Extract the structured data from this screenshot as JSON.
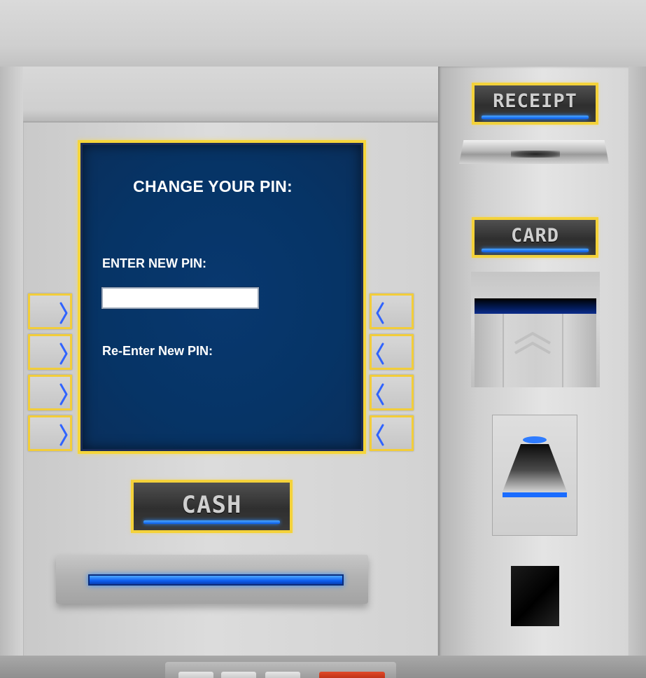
{
  "screen": {
    "title": "CHANGE YOUR PIN:",
    "new_pin_label": "ENTER NEW PIN:",
    "new_pin_value": "",
    "reenter_pin_label": "Re-Enter New PIN:"
  },
  "buttons": {
    "receipt_label": "RECEIPT",
    "card_label": "CARD",
    "cash_label": "CASH"
  },
  "side_buttons": {
    "left": [
      "chevron-right-icon",
      "chevron-right-icon",
      "chevron-right-icon",
      "chevron-right-icon"
    ],
    "right": [
      "chevron-left-icon",
      "chevron-left-icon",
      "chevron-left-icon",
      "chevron-left-icon"
    ]
  },
  "colors": {
    "screen_bg": "#063466",
    "accent_yellow": "#f4d23a",
    "glow_blue": "#0b5de8",
    "text": "#ffffff"
  }
}
